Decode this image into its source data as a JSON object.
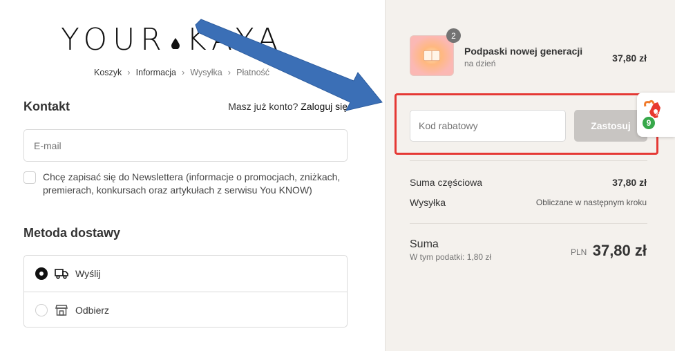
{
  "brand": {
    "logo_left": "YOUR",
    "logo_right": "KAYA"
  },
  "breadcrumb": [
    "Koszyk",
    "Informacja",
    "Wysyłka",
    "Płatność"
  ],
  "contact": {
    "title": "Kontakt",
    "account_prompt": "Masz już konto?",
    "login_link": "Zaloguj się",
    "email_placeholder": "E-mail",
    "newsletter_label": "Chcę zapisać się do Newslettera (informacje o promocjach, zniżkach, premierach, konkursach oraz artykułach z serwisu You KNOW)"
  },
  "delivery": {
    "title": "Metoda dostawy",
    "options": [
      {
        "label": "Wyślij",
        "icon": "truck-icon",
        "selected": true
      },
      {
        "label": "Odbierz",
        "icon": "store-icon",
        "selected": false
      }
    ]
  },
  "order": {
    "product": {
      "name": "Podpaski nowej generacji",
      "variant": "na dzień",
      "price": "37,80 zł",
      "quantity": "2"
    },
    "discount": {
      "placeholder": "Kod rabatowy",
      "apply_label": "Zastosuj"
    },
    "subtotal_label": "Suma częściowa",
    "subtotal_value": "37,80 zł",
    "shipping_label": "Wysyłka",
    "shipping_value": "Obliczane w następnym kroku",
    "total_label": "Suma",
    "tax_line": "W tym podatki: 1,80 zł",
    "currency": "PLN",
    "total_value": "37,80 zł"
  },
  "widget": {
    "count": "9",
    "icon": "rewards-gift-icon"
  },
  "colors": {
    "highlight_border": "#e53935",
    "arrow": "#3b6fb6",
    "sidebar_bg": "#f4f1ed",
    "apply_button": "#c8c5c2",
    "widget_badge": "#37a84a"
  }
}
